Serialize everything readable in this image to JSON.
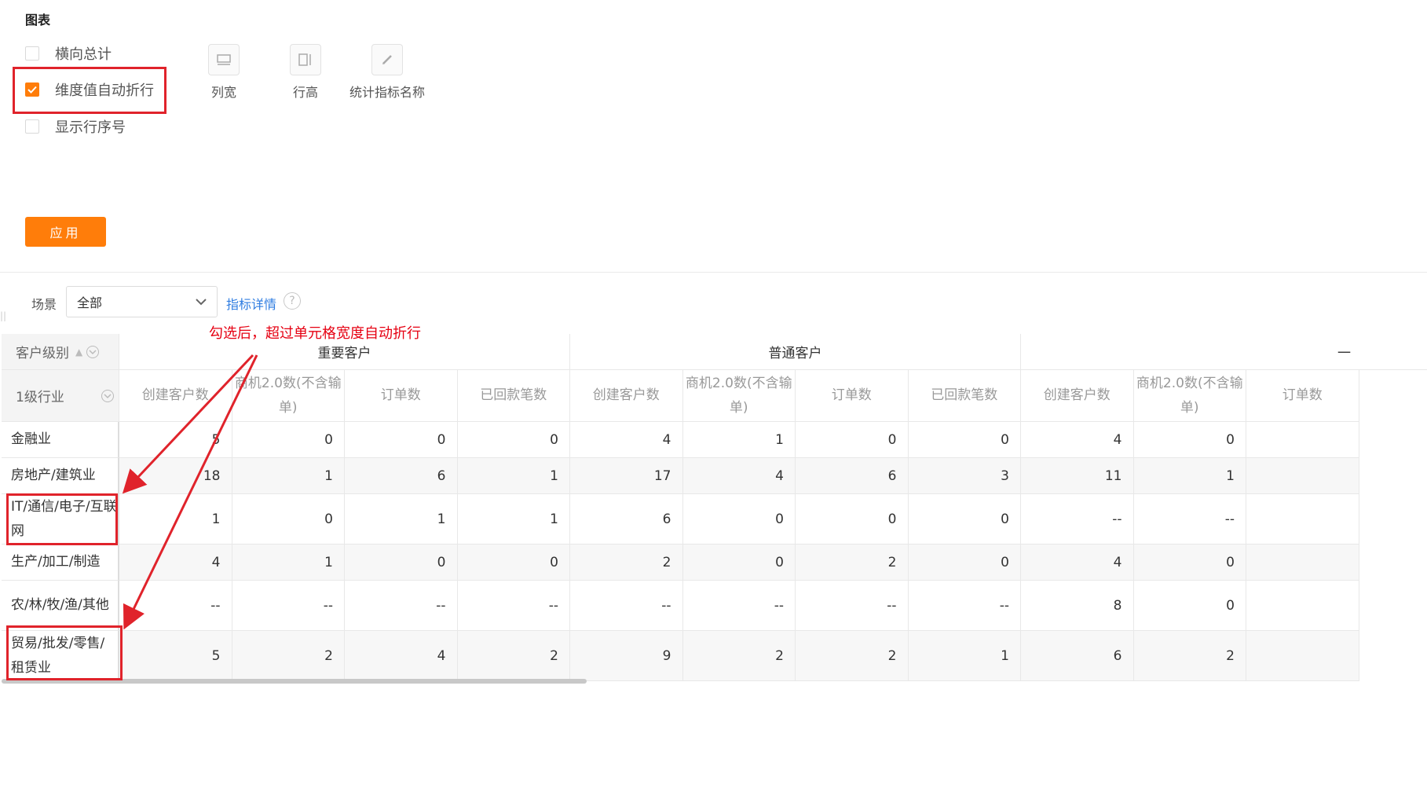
{
  "panel": {
    "title": "图表",
    "options": [
      {
        "label": "横向总计",
        "checked": false
      },
      {
        "label": "维度值自动折行",
        "checked": true
      },
      {
        "label": "显示行序号",
        "checked": false
      }
    ],
    "tools": [
      {
        "label": "列宽",
        "icon": "column-width-icon"
      },
      {
        "label": "行高",
        "icon": "row-height-icon"
      },
      {
        "label": "统计指标名称",
        "icon": "pencil-icon"
      }
    ],
    "apply_label": "应用"
  },
  "filter": {
    "scene_label": "场景",
    "scene_value": "全部",
    "indicator_link": "指标详情",
    "help_glyph": "?"
  },
  "annotation": {
    "text": "勾选后，超过单元格宽度自动折行",
    "color": "#e60012"
  },
  "table": {
    "dim1_label": "客户级别",
    "dim2_label": "1级行业",
    "groups": [
      "重要客户",
      "普通客户",
      "一"
    ],
    "metrics": [
      "创建客户数",
      "商机2.0数(不含输单)",
      "订单数",
      "已回款笔数"
    ],
    "rows": [
      {
        "label": "金融业",
        "values": [
          "5",
          "0",
          "0",
          "0",
          "4",
          "1",
          "0",
          "0",
          "4",
          "0"
        ]
      },
      {
        "label": "房地产/建筑业",
        "values": [
          "18",
          "1",
          "6",
          "1",
          "17",
          "4",
          "6",
          "3",
          "11",
          "1"
        ]
      },
      {
        "label": "IT/通信/电子/互联网",
        "values": [
          "1",
          "0",
          "1",
          "1",
          "6",
          "0",
          "0",
          "0",
          "--",
          "--"
        ]
      },
      {
        "label": "生产/加工/制造",
        "values": [
          "4",
          "1",
          "0",
          "0",
          "2",
          "0",
          "2",
          "0",
          "4",
          "0"
        ]
      },
      {
        "label": "农/林/牧/渔/其他",
        "values": [
          "--",
          "--",
          "--",
          "--",
          "--",
          "--",
          "--",
          "--",
          "8",
          "0"
        ]
      },
      {
        "label": "贸易/批发/零售/租赁业",
        "values": [
          "5",
          "2",
          "4",
          "2",
          "9",
          "2",
          "2",
          "1",
          "6",
          "2"
        ]
      }
    ]
  },
  "colors": {
    "accent": "#ff7d0a",
    "link": "#2f7de1",
    "annotation": "#e0232b"
  }
}
